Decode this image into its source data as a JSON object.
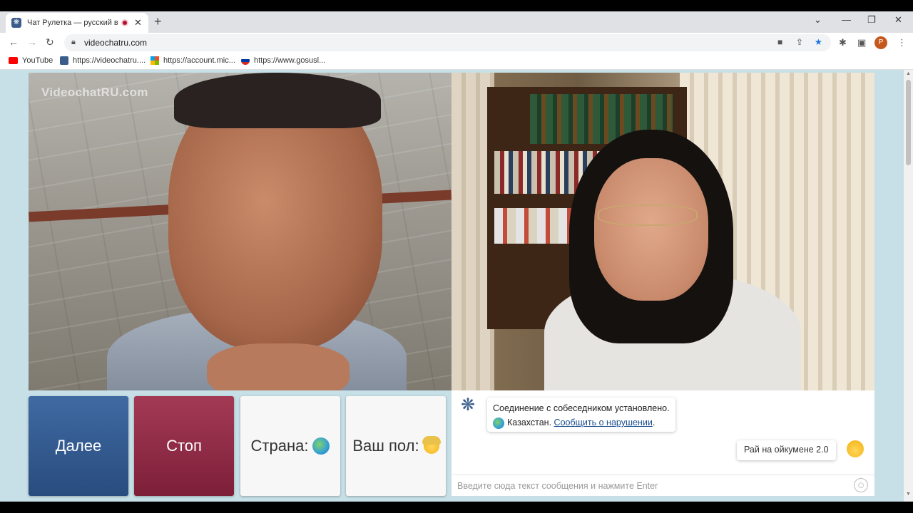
{
  "browser": {
    "tab_title": "Чат Рулетка — русский видео",
    "url": "videochatru.com",
    "bookmarks": [
      {
        "label": "YouTube",
        "icon": "youtube-icon",
        "color": "#ff0000"
      },
      {
        "label": "https://videochatru....",
        "icon": "videochatru-icon",
        "color": "#3b5d8c"
      },
      {
        "label": "https://account.mic...",
        "icon": "microsoft-icon",
        "color": "#f25022"
      },
      {
        "label": "https://www.gosusl...",
        "icon": "gosuslugi-icon",
        "color": "#d52b1e"
      }
    ],
    "profile_initial": "P"
  },
  "video": {
    "watermark": "VideochatRU.com"
  },
  "controls": {
    "next_label": "Далее",
    "stop_label": "Стоп",
    "country_label": "Страна:",
    "gender_label": "Ваш пол:"
  },
  "chat": {
    "system_line1": "Соединение с собеседником установлено.",
    "country": "Казахстан.",
    "report_link": "Сообщить о нарушении",
    "user_message": "Рай на ойкумене 2.0",
    "input_placeholder": "Введите сюда текст сообщения и нажмите Enter"
  },
  "colors": {
    "next_button": "#34598f",
    "stop_button": "#912c48",
    "page_background": "#c7dfe6"
  }
}
